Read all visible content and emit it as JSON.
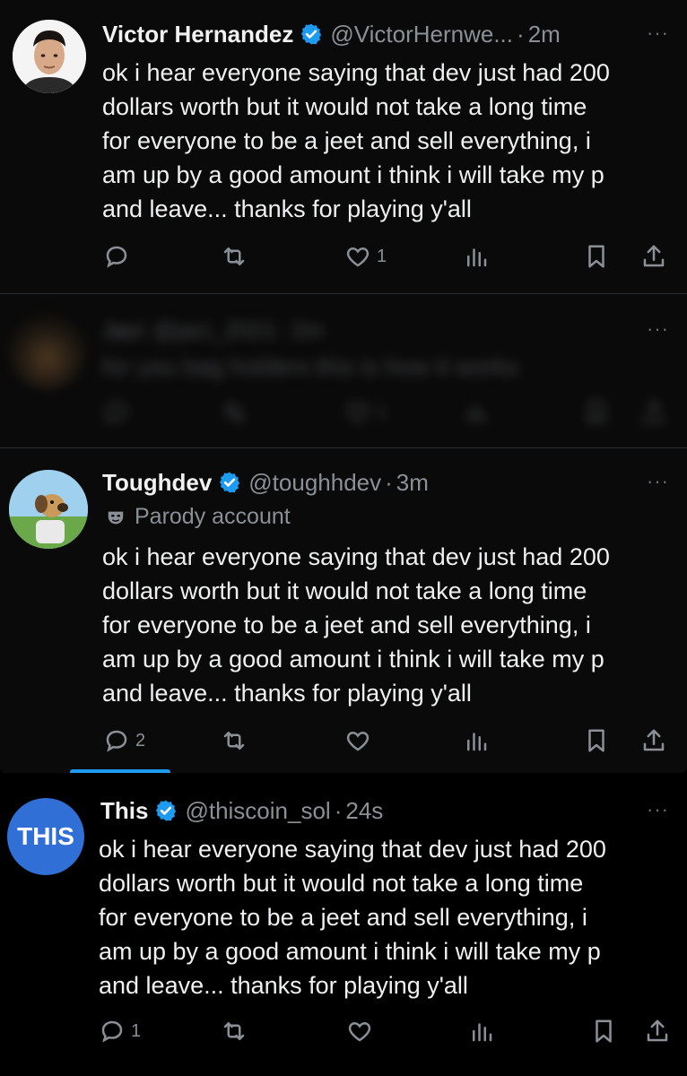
{
  "posts": [
    {
      "name": "Victor Hernandez",
      "handle": "@VictorHernwe...",
      "separator": "·",
      "time": "2m",
      "text": "ok i hear everyone saying that dev just had 200\ndollars worth but it would not take a long time\nfor everyone to be a jeet and sell everything, i\nam up by a good amount i think i will take my p\nand leave... thanks for playing y'all",
      "counts": {
        "replies": "",
        "reposts": "",
        "likes": "1"
      }
    },
    {
      "name": "Jaci",
      "handle": "@jaci_2021",
      "separator": "·",
      "time": "2m",
      "text": "for you bag holders this is how it works",
      "counts": {
        "replies": "",
        "reposts": "",
        "likes": "1"
      }
    },
    {
      "name": "Toughdev",
      "handle": "@toughhdev",
      "separator": "·",
      "time": "3m",
      "parody_label": "Parody account",
      "text": "ok i hear everyone saying that dev just had 200\ndollars worth but it would not take a long time\nfor everyone to be a jeet and sell everything, i\nam up by a good amount i think i will take my p\nand leave... thanks for playing y'all",
      "counts": {
        "replies": "2",
        "reposts": "",
        "likes": ""
      }
    },
    {
      "name": "This",
      "handle": "@thiscoin_sol",
      "separator": "·",
      "time": "24s",
      "avatar_text": "THIS",
      "text": "ok i hear everyone saying that dev just had 200\ndollars worth but it would not take a long time\nfor everyone to be a jeet and sell everything, i\nam up by a good amount i think i will take my p\nand leave... thanks for playing y'all",
      "counts": {
        "replies": "1",
        "reposts": "",
        "likes": ""
      }
    }
  ],
  "more_glyph": "···",
  "colors": {
    "background": "#000000",
    "verified": "#1d9bf0",
    "muted_text": "#8b9097",
    "this_avatar": "#2f6fd6"
  },
  "icons": [
    "verified-badge-icon",
    "reply-icon",
    "repost-icon",
    "like-icon",
    "views-icon",
    "bookmark-icon",
    "share-icon",
    "more-icon",
    "parody-mask-icon"
  ]
}
